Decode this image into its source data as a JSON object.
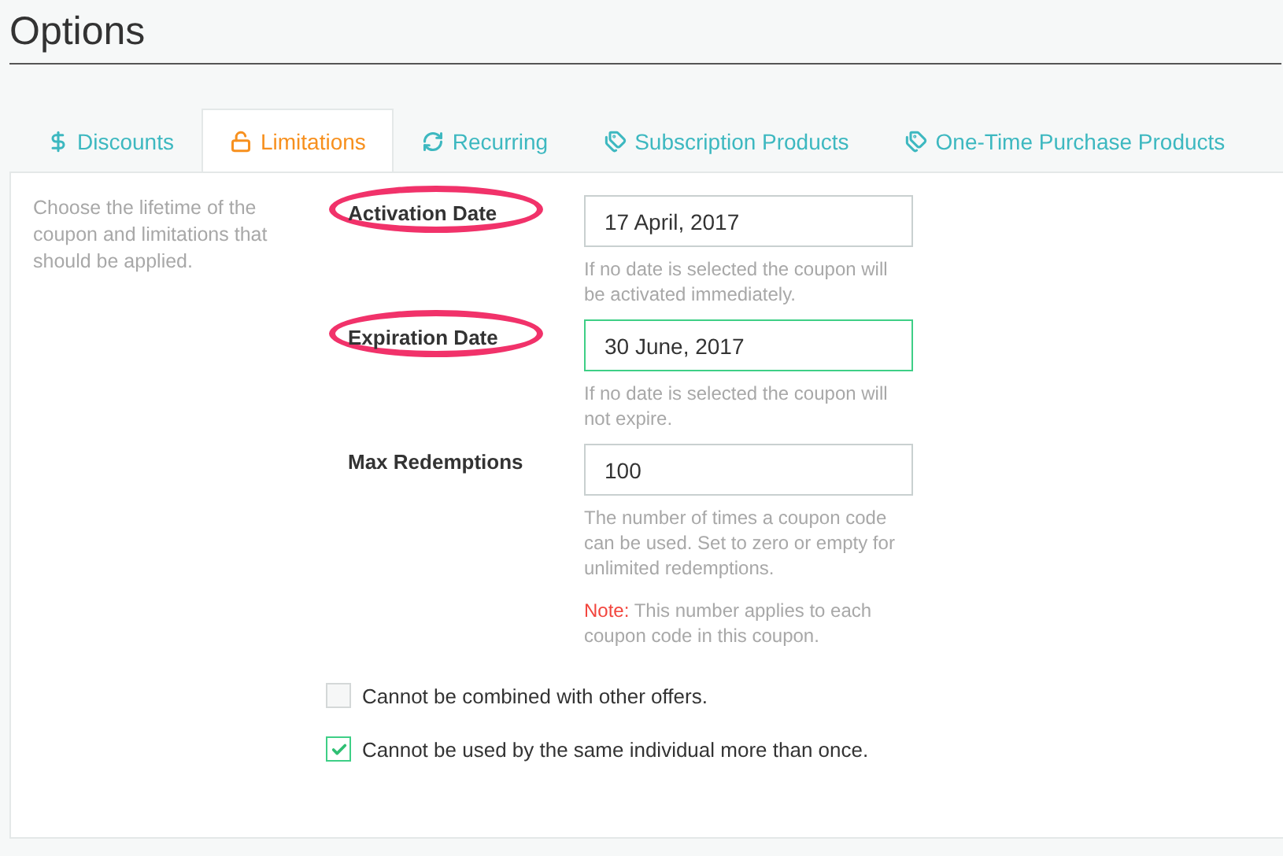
{
  "title": "Options",
  "tabs": [
    {
      "label": "Discounts",
      "selected": false
    },
    {
      "label": "Limitations",
      "selected": true
    },
    {
      "label": "Recurring",
      "selected": false
    },
    {
      "label": "Subscription Products",
      "selected": false
    },
    {
      "label": "One-Time Purchase Products",
      "selected": false
    }
  ],
  "description": "Choose the lifetime of the coupon and limitations that should be applied.",
  "fields": [
    {
      "label": "Activation Date",
      "value": "17 April, 2017",
      "focused": false,
      "circled": true,
      "help": [
        "If no date is selected the coupon will be activated immediately."
      ]
    },
    {
      "label": "Expiration Date",
      "value": "30 June, 2017",
      "focused": true,
      "circled": true,
      "help": [
        "If no date is selected the coupon will not expire."
      ]
    },
    {
      "label": "Max Redemptions",
      "value": "100",
      "focused": false,
      "circled": false,
      "help": [
        "The number of times a coupon code can be used. Set to zero or empty for unlimited redemptions."
      ],
      "note": {
        "label": "Note:",
        "text": "This number applies to each coupon code in this coupon."
      }
    }
  ],
  "checkboxes": [
    {
      "label": "Cannot be combined with other offers.",
      "checked": false
    },
    {
      "label": "Cannot be used by the same individual more than once.",
      "checked": true
    }
  ]
}
